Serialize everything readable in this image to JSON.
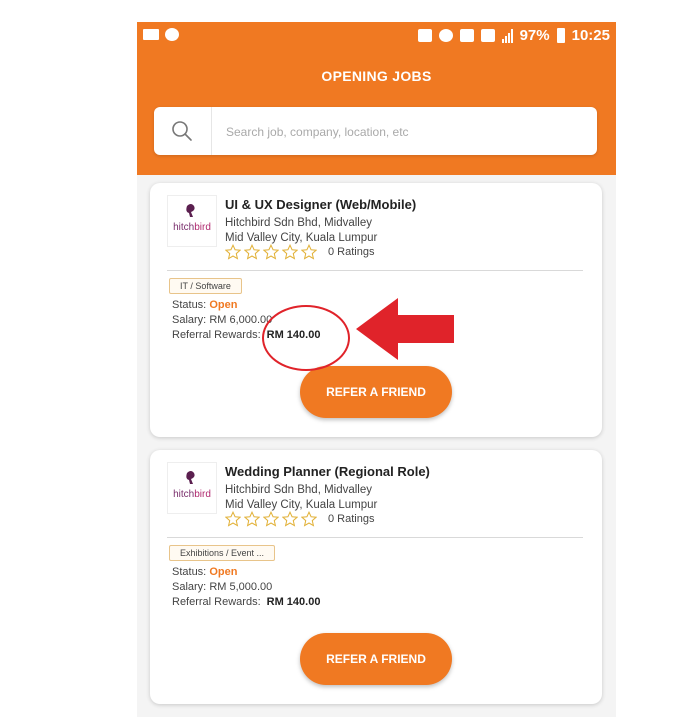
{
  "status_bar": {
    "battery": "97%",
    "time": "10:25"
  },
  "header": {
    "title": "OPENING JOBS"
  },
  "search": {
    "placeholder": "Search job, company, location, etc"
  },
  "jobs": [
    {
      "logo_text_1": "hitch",
      "logo_text_2": "bird",
      "title": "UI & UX Designer (Web/Mobile)",
      "company": "Hitchbird Sdn Bhd, Midvalley",
      "location": "Mid Valley City, Kuala Lumpur",
      "ratings": "0 Ratings",
      "stars": 0,
      "tag": "IT / Software",
      "status_label": "Status:",
      "status_value": "Open",
      "salary_label": "Salary:",
      "salary_value": "RM 6,000.00",
      "reward_label": "Referral Rewards:",
      "reward_value": "RM 140.00",
      "button": "REFER A FRIEND"
    },
    {
      "logo_text_1": "hitch",
      "logo_text_2": "bird",
      "title": "Wedding Planner (Regional Role)",
      "company": "Hitchbird Sdn Bhd, Midvalley",
      "location": "Mid Valley City, Kuala Lumpur",
      "ratings": "0 Ratings",
      "stars": 0,
      "tag": "Exhibitions / Event ...",
      "status_label": "Status:",
      "status_value": "Open",
      "salary_label": "Salary:",
      "salary_value": "RM 5,000.00",
      "reward_label": "Referral Rewards:",
      "reward_value": "RM 140.00",
      "button": "REFER A FRIEND"
    }
  ],
  "colors": {
    "brand": "#f07922",
    "annotation": "#e0232a",
    "star": "#e2b23a"
  }
}
